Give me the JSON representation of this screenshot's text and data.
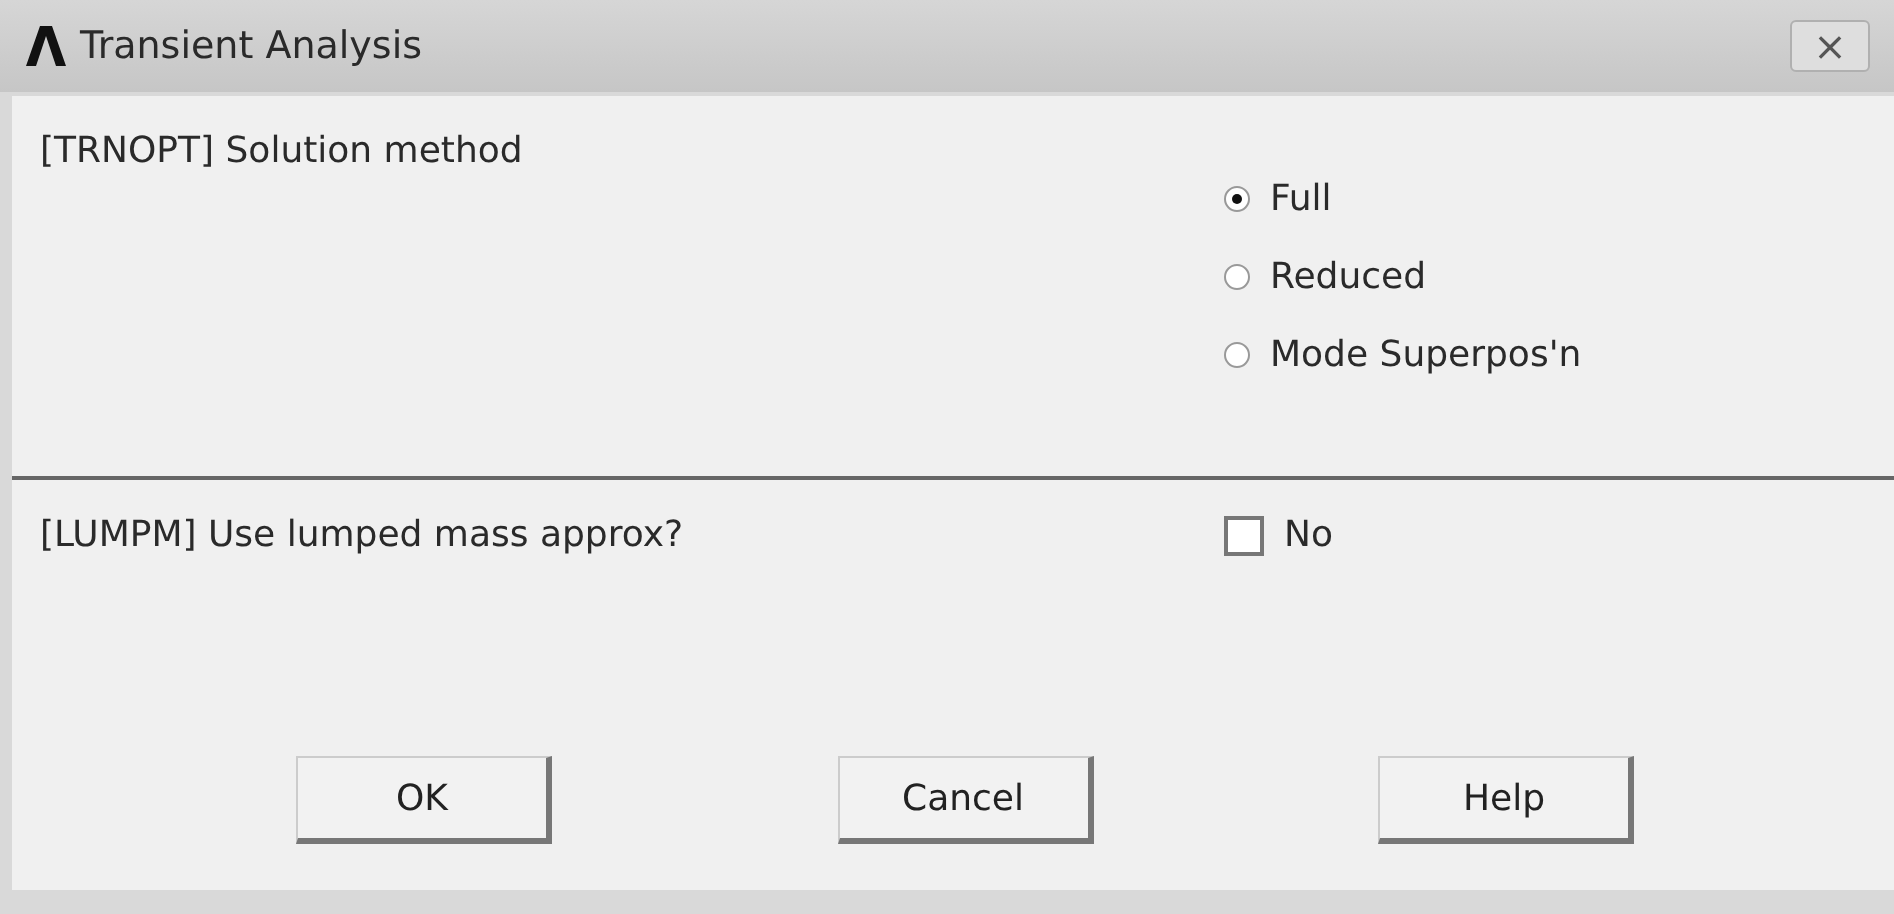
{
  "window": {
    "title": "Transient Analysis",
    "close": "×"
  },
  "sections": [
    {
      "kind": "radio",
      "label": "[TRNOPT]  Solution method",
      "options": [
        {
          "label": "Full",
          "selected": true
        },
        {
          "label": "Reduced",
          "selected": false
        },
        {
          "label": "Mode Superpos'n",
          "selected": false
        }
      ]
    },
    {
      "kind": "checkbox",
      "label": "[LUMPM]  Use lumped mass approx?",
      "checked": false,
      "option": "No"
    }
  ],
  "buttons": [
    "OK",
    "Cancel",
    "Help"
  ]
}
